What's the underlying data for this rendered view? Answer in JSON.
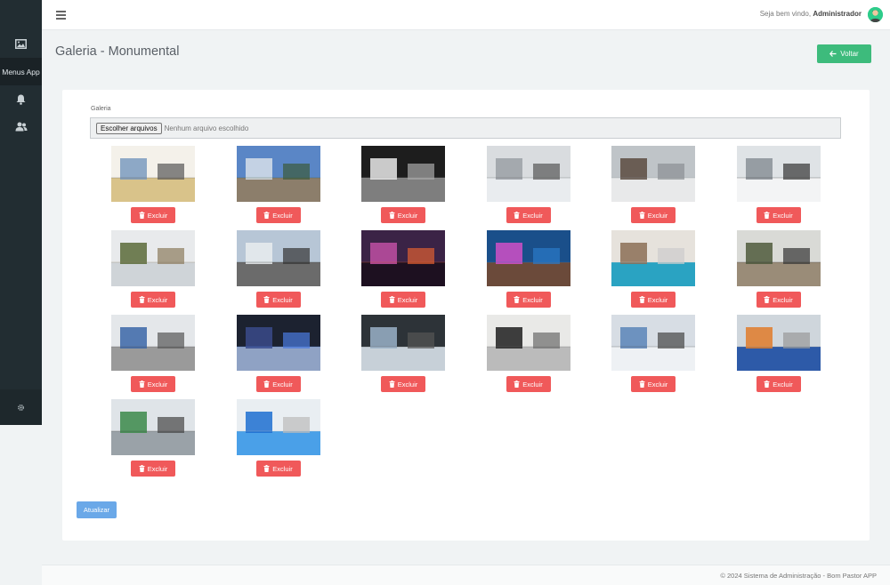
{
  "sidebar": {
    "items": [
      {
        "icon": "image-icon"
      },
      {
        "label": "Menus App"
      },
      {
        "icon": "bell-icon"
      },
      {
        "icon": "users-icon"
      }
    ],
    "settings_icon": "gear-icon"
  },
  "topbar": {
    "welcome_prefix": "Seja bem vindo,",
    "user_name": "Administrador"
  },
  "page": {
    "title": "Galeria - Monumental",
    "back_label": "Voltar"
  },
  "form": {
    "field_label": "Galeria",
    "file_button": "Escolher arquivos",
    "file_status": "Nenhum arquivo escolhido",
    "delete_label": "Excluir",
    "update_label": "Atualizar"
  },
  "gallery": {
    "count": 20
  },
  "footer": {
    "text": "© 2024 Sistema de Administração - Bom Pastor APP"
  },
  "colors": {
    "sidebar": "#222d32",
    "success": "#3dbb7c",
    "danger": "#f0595a",
    "primary": "#6aa8e8"
  }
}
